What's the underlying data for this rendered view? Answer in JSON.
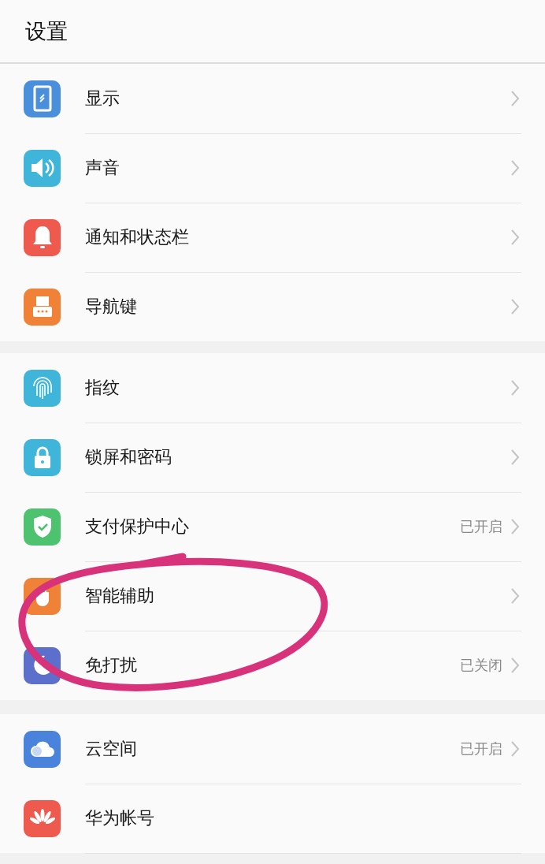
{
  "header": {
    "title": "设置"
  },
  "groups": [
    {
      "items": [
        {
          "label": "显示",
          "chevron": true
        },
        {
          "label": "声音",
          "chevron": true
        },
        {
          "label": "通知和状态栏",
          "chevron": true
        },
        {
          "label": "导航键",
          "chevron": true
        }
      ]
    },
    {
      "items": [
        {
          "label": "指纹",
          "chevron": true
        },
        {
          "label": "锁屏和密码",
          "chevron": true
        },
        {
          "label": "支付保护中心",
          "status": "已开启",
          "chevron": true
        },
        {
          "label": "智能辅助",
          "chevron": true
        },
        {
          "label": "免打扰",
          "status": "已关闭",
          "chevron": true
        }
      ]
    },
    {
      "items": [
        {
          "label": "云空间",
          "status": "已开启",
          "chevron": true
        },
        {
          "label": "华为帐号",
          "chevron": false
        }
      ]
    }
  ],
  "annotation": {
    "kind": "ellipse"
  }
}
